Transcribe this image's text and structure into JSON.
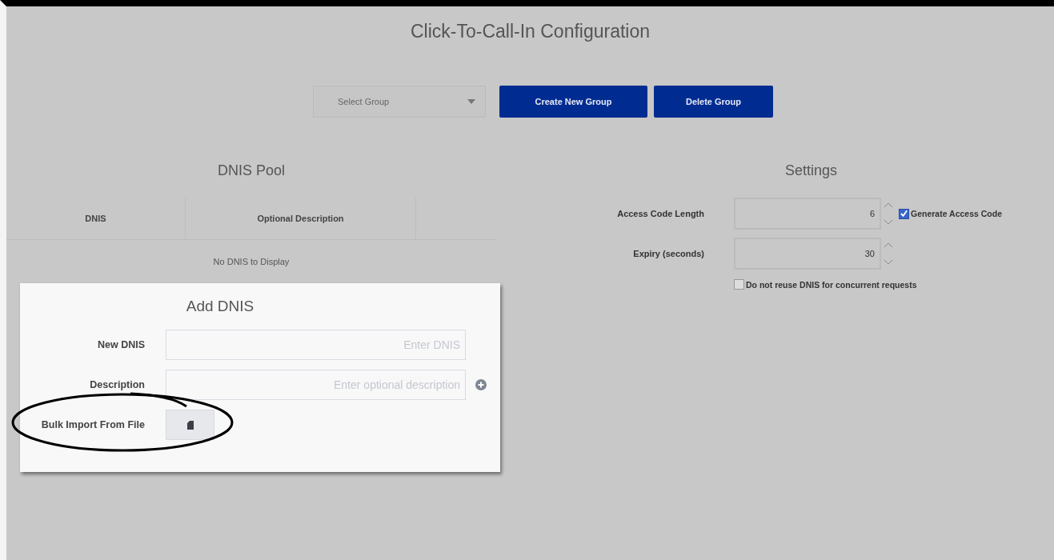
{
  "title": "Click-To-Call-In Configuration",
  "toolbar": {
    "group_select": {
      "placeholder": "Select Group"
    },
    "buttons": [
      "Create New Group",
      "Delete Group"
    ]
  },
  "dnis_pool": {
    "title": "DNIS Pool",
    "columns": [
      "DNIS",
      "Optional Description"
    ],
    "empty_message": "No DNIS to Display"
  },
  "settings": {
    "title": "Settings",
    "fields": [
      {
        "label": "Access Code Length",
        "value": "6",
        "checkbox": {
          "label": "Generate Access Code",
          "checked": true
        }
      },
      {
        "label": "Expiry (seconds)",
        "value": "30"
      }
    ],
    "options": [
      {
        "label": "Do not reuse DNIS for concurrent requests",
        "checked": false
      }
    ]
  },
  "add_dnis": {
    "title": "Add DNIS",
    "fields": [
      {
        "label": "New DNIS",
        "placeholder": "Enter DNIS",
        "add_button": false
      },
      {
        "label": "Description",
        "placeholder": "Enter optional description",
        "add_button": true
      }
    ],
    "bulk_import": {
      "label": "Bulk Import From File"
    }
  }
}
